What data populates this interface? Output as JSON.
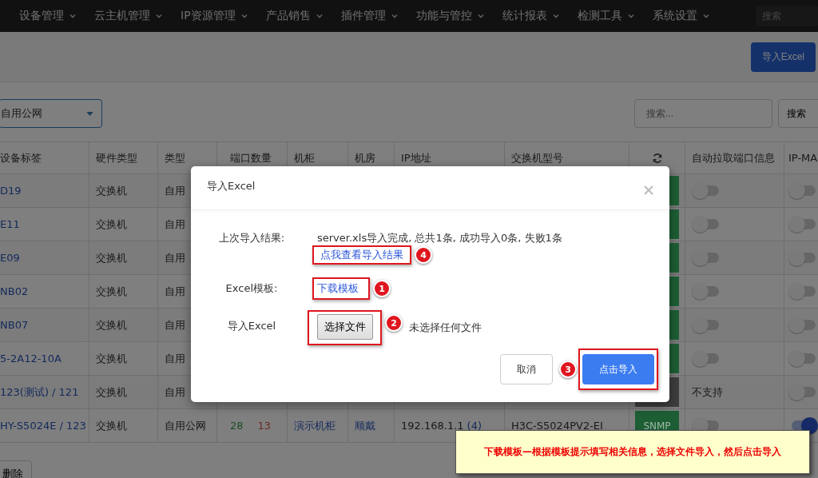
{
  "nav": {
    "items": [
      {
        "label": "设备管理"
      },
      {
        "label": "云主机管理"
      },
      {
        "label": "IP资源管理"
      },
      {
        "label": "产品销售"
      },
      {
        "label": "插件管理"
      },
      {
        "label": "功能与管控"
      },
      {
        "label": "统计报表"
      },
      {
        "label": "检测工具"
      },
      {
        "label": "系统设置"
      }
    ],
    "search": {
      "placeholder": "搜索"
    }
  },
  "toolbar": {
    "import_button": "导入Excel"
  },
  "filter": {
    "select": "自用公网",
    "search": {
      "placeholder": "搜索..."
    },
    "search_button": "搜索"
  },
  "table": {
    "columns": [
      {
        "kind": "text",
        "label": "设备标签"
      },
      {
        "kind": "text",
        "label": "硬件类型"
      },
      {
        "kind": "text",
        "label": "类型"
      },
      {
        "kind": "text",
        "label": "端口数量"
      },
      {
        "kind": "text",
        "label": "机柜"
      },
      {
        "kind": "text",
        "label": "机房"
      },
      {
        "kind": "text",
        "label": "IP地址"
      },
      {
        "kind": "text",
        "label": "交换机型号"
      },
      {
        "kind": "icon"
      },
      {
        "kind": "text",
        "label": "自动拉取端口信息"
      },
      {
        "kind": "text",
        "label": "IP-MA"
      }
    ],
    "rows": [
      {
        "label": "D19",
        "hardware": "交换机",
        "type": "自用",
        "status": {
          "color": "#1d5e34"
        },
        "auto_pull": {
          "kind": "toggle",
          "on": false
        },
        "ip_mac": {
          "on": false
        }
      },
      {
        "label": "E11",
        "hardware": "交换机",
        "type": "自用",
        "status": {
          "color": "#1d5e34"
        },
        "auto_pull": {
          "kind": "toggle",
          "on": false
        },
        "ip_mac": {
          "on": false
        }
      },
      {
        "label": "E09",
        "hardware": "交换机",
        "type": "自用",
        "status": {
          "color": "#1d5e34"
        },
        "auto_pull": {
          "kind": "toggle",
          "on": false
        },
        "ip_mac": {
          "on": false
        }
      },
      {
        "label": "NB02",
        "hardware": "交换机",
        "type": "自用",
        "status": {
          "color": "#1d5e34"
        },
        "auto_pull": {
          "kind": "toggle",
          "on": false
        },
        "ip_mac": {
          "on": false
        }
      },
      {
        "label": "NB07",
        "hardware": "交换机",
        "type": "自用",
        "status": {
          "color": "#1d5e34"
        },
        "auto_pull": {
          "kind": "toggle",
          "on": false
        },
        "ip_mac": {
          "on": false
        }
      },
      {
        "label": "5-2A12-10A",
        "hardware": "交换机",
        "type": "自用",
        "status": {
          "color": "#1d5e34"
        },
        "auto_pull": {
          "kind": "toggle",
          "on": false
        },
        "ip_mac": {
          "on": false
        }
      },
      {
        "label": "123(测试) / 121",
        "hardware": "交换机",
        "type": "自用",
        "status": {
          "color": "#3e3e3e"
        },
        "auto_pull": {
          "kind": "text",
          "text": "不支持"
        },
        "ip_mac": {
          "on": false
        }
      },
      {
        "label": "HY-S5024E / 123",
        "hardware": "交换机",
        "type": "自用公网",
        "ports_up": "28",
        "ports_down": "13",
        "cabinet": "演示机柜",
        "room": "顺戴",
        "ip": "192.168.1.1",
        "ip_count": "(4)",
        "model": "H3C-S5024PV2-EI",
        "status": {
          "color": "#1d5e34",
          "text": "SNMP"
        },
        "auto_pull": {
          "kind": "toggle",
          "on": false
        },
        "ip_mac": {
          "on": true
        }
      }
    ]
  },
  "delete_button": "删除",
  "modal": {
    "title": "导入Excel",
    "last_result": {
      "label": "上次导入结果:",
      "text": "server.xls导入完成, 总共1条, 成功导入0条, 失败1条",
      "link": {
        "text": "点我查看导入结果",
        "highlighted": true,
        "step": "4"
      }
    },
    "template": {
      "label": "Excel模板:",
      "link": {
        "text": "下载模板",
        "highlighted": true,
        "step": "1"
      }
    },
    "file": {
      "label": "导入Excel",
      "button": {
        "text": "选择文件",
        "highlighted": true,
        "step": "2"
      },
      "status": "未选择任何文件"
    },
    "buttons": [
      {
        "kind": "secondary",
        "text": "取消",
        "highlighted": false
      },
      {
        "kind": "primary",
        "text": "点击导入",
        "highlighted": true,
        "step": "3"
      }
    ]
  },
  "note": {
    "text": "下载模板—根据模板提示填写相关信息，选择文件导入，然后点击导入"
  }
}
